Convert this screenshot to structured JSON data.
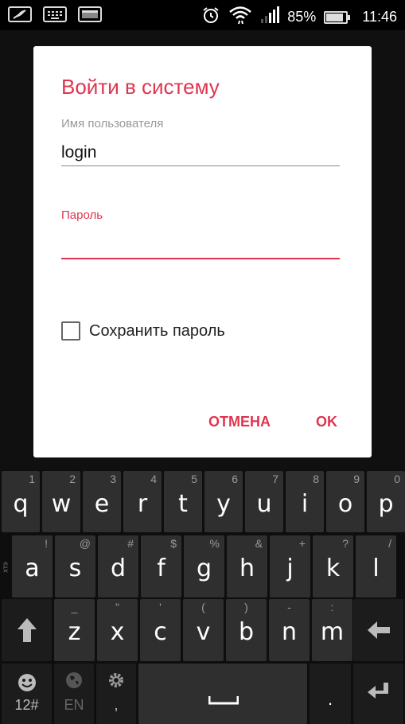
{
  "status_bar": {
    "battery": "85%",
    "time": "11:46",
    "battery_level": 0.85
  },
  "dialog": {
    "title": "Войти в систему",
    "username_label": "Имя пользователя",
    "username_value": "login",
    "password_label": "Пароль",
    "password_value": "",
    "save_password_label": "Сохранить пароль",
    "save_password_checked": false,
    "cancel_label": "ОТМЕНА",
    "ok_label": "OK"
  },
  "keyboard": {
    "row1": [
      {
        "main": "q",
        "sub": "1"
      },
      {
        "main": "w",
        "sub": "2"
      },
      {
        "main": "e",
        "sub": "3"
      },
      {
        "main": "r",
        "sub": "4"
      },
      {
        "main": "t",
        "sub": "5"
      },
      {
        "main": "y",
        "sub": "6"
      },
      {
        "main": "u",
        "sub": "7"
      },
      {
        "main": "i",
        "sub": "8"
      },
      {
        "main": "o",
        "sub": "9"
      },
      {
        "main": "p",
        "sub": "0"
      }
    ],
    "row2": [
      {
        "main": "a",
        "sub": "!"
      },
      {
        "main": "s",
        "sub": "@"
      },
      {
        "main": "d",
        "sub": "#"
      },
      {
        "main": "f",
        "sub": "$"
      },
      {
        "main": "g",
        "sub": "%"
      },
      {
        "main": "h",
        "sub": "&"
      },
      {
        "main": "j",
        "sub": "+"
      },
      {
        "main": "k",
        "sub": "?"
      },
      {
        "main": "l",
        "sub": "/"
      }
    ],
    "row2_side_label": "хтэ",
    "row3": [
      {
        "main": "z",
        "sub": "_"
      },
      {
        "main": "x",
        "sub": "\""
      },
      {
        "main": "c",
        "sub": "'"
      },
      {
        "main": "v",
        "sub": "("
      },
      {
        "main": "b",
        "sub": ")"
      },
      {
        "main": "n",
        "sub": "-"
      },
      {
        "main": "m",
        "sub": ":"
      }
    ],
    "numbers_key": "12#",
    "language_key": "EN",
    "comma_key": ",",
    "period_key": "."
  }
}
